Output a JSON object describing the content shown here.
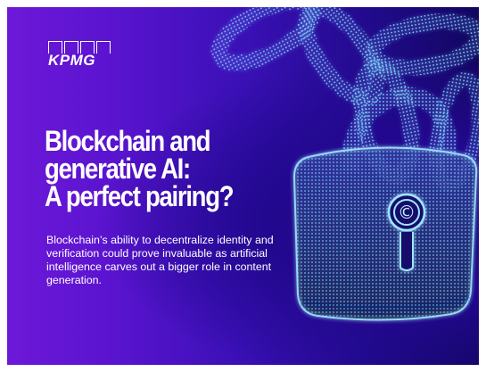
{
  "brand": {
    "logo_text": "KPMG"
  },
  "headline": {
    "lines": [
      "Blockchain and",
      "generative AI:",
      "A perfect pairing?"
    ]
  },
  "subtitle": "Blockchain’s ability to decentralize identity and verification could prove invaluable as artificial intelligence carves out a bigger role in content generation.",
  "padlock": {
    "symbol": "©"
  },
  "colors": {
    "background_left": "#6d18d8",
    "background_right": "#120660",
    "accent_glow": "#3ec8ff",
    "text": "#ffffff"
  },
  "icons": [
    "chain-icon",
    "padlock-icon",
    "copyright-icon"
  ]
}
